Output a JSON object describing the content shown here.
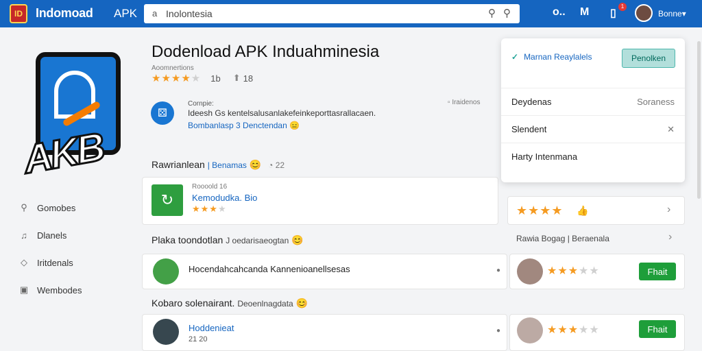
{
  "topbar": {
    "brand": "Indomoad",
    "brand_sub": "APK",
    "search_prefix": "a",
    "search_value": "Inolontesia",
    "search_icons": [
      "⚲",
      "⚲"
    ],
    "icon_1": "o..",
    "icon_2": "M",
    "icon_3": "▯",
    "notification_count": "1",
    "user": "Bonne▾"
  },
  "app": {
    "logo_text": "AKB",
    "title": "Dodenload APK Induahminesia",
    "developer": "Aoomnertions",
    "stars": "★★★★",
    "stars_off": "★",
    "rating": "1b",
    "downloads": "18"
  },
  "sidebar": {
    "items": [
      {
        "label": "Gomobes",
        "icon": "⚲"
      },
      {
        "label": "Dlanels",
        "icon": "♫"
      },
      {
        "label": "Iritdenals",
        "icon": "◇"
      },
      {
        "label": "Wembodes",
        "icon": "▣"
      }
    ]
  },
  "info_card": {
    "label": "Cornpie:",
    "text": "Ideesh Gs kentelsalusanlakefeinkeporttasrallacaen.",
    "link": "Bombanlasp 3 Denctendan",
    "emoji": "😑",
    "meta": "Iraidenos"
  },
  "section_rec": {
    "title": "Rawrianlean",
    "link": "| Benamas",
    "emoji": "😊",
    "count": "22"
  },
  "rec_card": {
    "small": "Roooold 16",
    "link": "Kemodudka. Bio",
    "stars": "★★★",
    "stars_off": "★"
  },
  "rating_card": {
    "stars": "★★★★",
    "icon": "👍"
  },
  "dropdown": {
    "top_label": "Marnan Reaylalels",
    "button": "Penolken",
    "rows": [
      {
        "label": "Deydenas",
        "right": "Soraness"
      },
      {
        "label": "Slendent",
        "right": "✕"
      },
      {
        "label": "Harty Intenmana",
        "right": ""
      }
    ]
  },
  "section_popular": {
    "title": "Plaka toondotlan",
    "link": "J oedarisaeogtan",
    "emoji": "😊",
    "side_link": "Rawia Bogag | Beraenala"
  },
  "popular_row": {
    "text": "Hocendahcahcanda Kannenioanellsesas",
    "stars": "★★★",
    "stars_half": "★★",
    "button": "Fhait"
  },
  "section_kobaro": {
    "title": "Kobaro solenairant.",
    "link": "Deoenlnagdata",
    "emoji": "😊"
  },
  "kobaro_row": {
    "link": "Hoddenieat",
    "sub": "21 20",
    "stars": "★★★",
    "stars_half": "★★",
    "button": "Fhait"
  }
}
